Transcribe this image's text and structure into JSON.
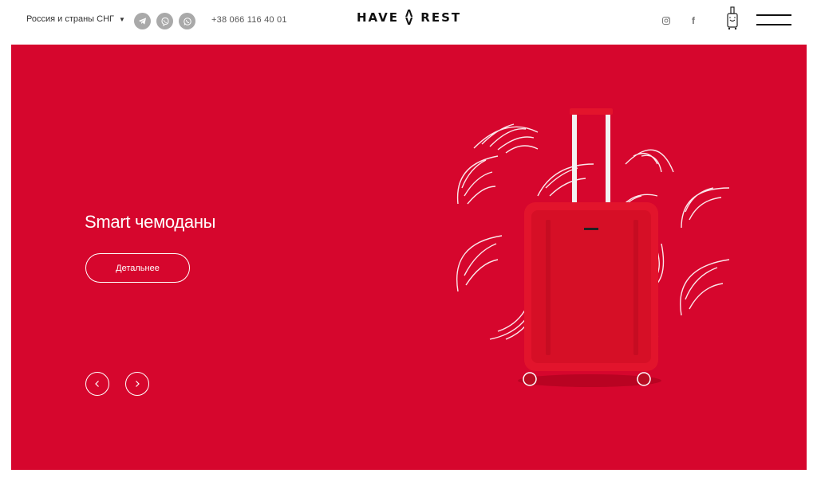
{
  "header": {
    "region_label": "Россия и страны СНГ",
    "region_caret": "▼",
    "phone": "+38 066 116 40 01",
    "logo_left": "HAVE",
    "logo_mark_top": "Λ",
    "logo_mark_bottom": "V",
    "logo_right": "REST",
    "messengers": [
      "telegram-icon",
      "viber-icon",
      "whatsapp-icon"
    ],
    "social": [
      "instagram-icon",
      "facebook-icon"
    ],
    "social_facebook_glyph": "f"
  },
  "hero": {
    "title": "Smart чемоданы",
    "cta_label": "Детальнее",
    "background": "#d6062d",
    "prev_icon": "chevron-left-icon",
    "next_icon": "chevron-right-icon"
  }
}
